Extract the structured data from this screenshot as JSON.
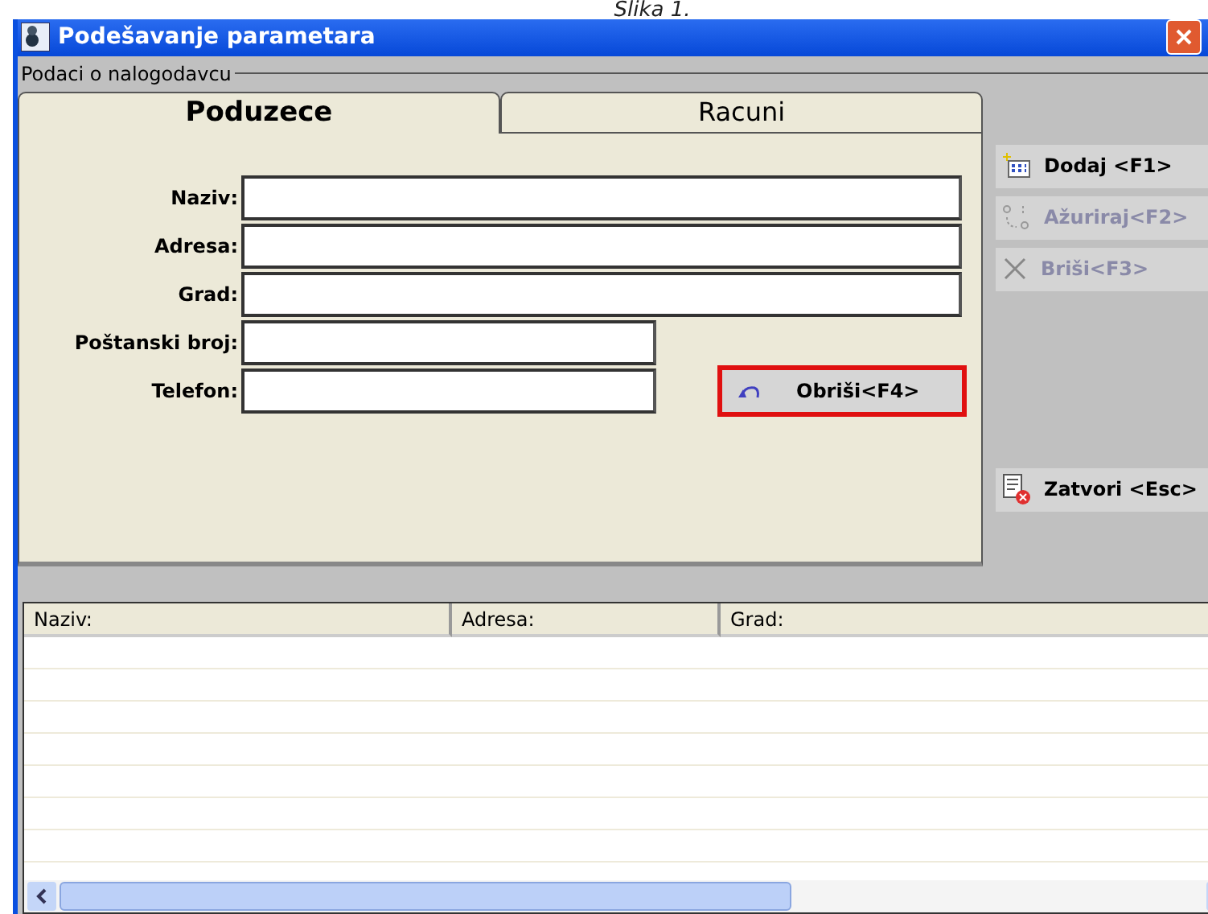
{
  "caption": "Slika 1.",
  "window": {
    "title": "Podešavanje parametara"
  },
  "group": {
    "title": "Podaci o nalogodavcu"
  },
  "tabs": [
    {
      "label": "Poduzece",
      "selected": true
    },
    {
      "label": "Racuni",
      "selected": false
    }
  ],
  "fields": [
    {
      "label": "Naziv:",
      "kind": "wide"
    },
    {
      "label": "Adresa:",
      "kind": "wide"
    },
    {
      "label": "Grad:",
      "kind": "wide"
    },
    {
      "label": "Poštanski broj:",
      "kind": "short"
    },
    {
      "label": "Telefon:",
      "kind": "short"
    }
  ],
  "clear_button": {
    "label": "Obriši<F4>",
    "highlighted": true
  },
  "side_buttons": [
    {
      "label": "Dodaj <F1>",
      "kind": "add",
      "disabled": false
    },
    {
      "label": "Ažuriraj<F2>",
      "kind": "update",
      "disabled": true
    },
    {
      "label": "Briši<F3>",
      "kind": "delete",
      "disabled": true
    }
  ],
  "close_button": {
    "label": "Zatvori <Esc>"
  },
  "table": {
    "columns": [
      "Naziv:",
      "Adresa:",
      "Grad:"
    ]
  }
}
